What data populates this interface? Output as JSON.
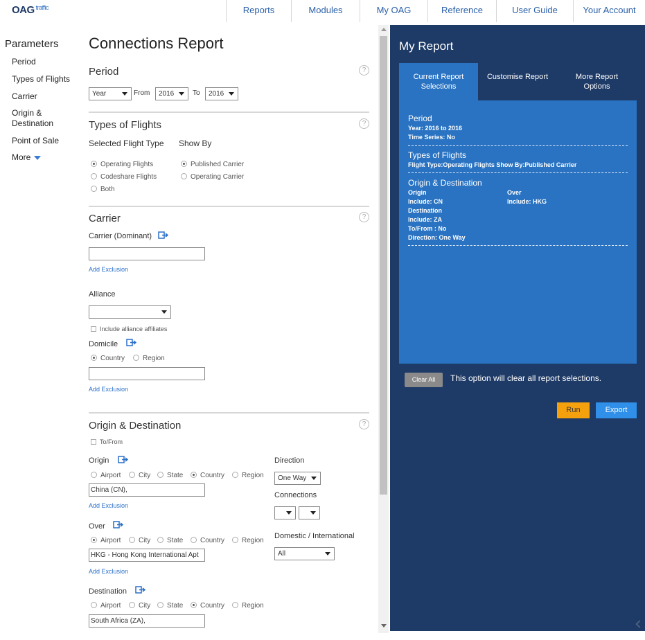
{
  "logo": {
    "main": "OAG",
    "sub": "traffic"
  },
  "nav": [
    {
      "label": "Reports",
      "name": "nav-reports"
    },
    {
      "label": "Modules",
      "name": "nav-modules"
    },
    {
      "label": "My OAG",
      "name": "nav-my-oag"
    },
    {
      "label": "Reference",
      "name": "nav-reference"
    },
    {
      "label": "User Guide",
      "name": "nav-user-guide"
    },
    {
      "label": "Your Account",
      "name": "nav-your-account"
    }
  ],
  "params": {
    "title": "Parameters",
    "items": [
      "Period",
      "Types of Flights",
      "Carrier",
      "Origin &",
      "Destination",
      "Point of Sale"
    ],
    "more": "More"
  },
  "form": {
    "page_title": "Connections Report",
    "help": "?",
    "period": {
      "title": "Period",
      "period_type": "Year",
      "from_label": "From",
      "from_value": "2016",
      "to_label": "To",
      "to_value": "2016"
    },
    "types": {
      "title": "Types of Flights",
      "selected_label": "Selected Flight Type",
      "show_by_label": "Show By",
      "flight_types": [
        "Operating Flights",
        "Codeshare Flights",
        "Both"
      ],
      "show_by": [
        "Published Carrier",
        "Operating Carrier"
      ]
    },
    "carrier": {
      "title": "Carrier",
      "dominant_label": "Carrier (Dominant)",
      "dominant_value": "",
      "add_exclusion": "Add Exclusion",
      "alliance_label": "Alliance",
      "alliance_value": "",
      "include_affiliates": "Include alliance affiliates",
      "domicile_label": "Domicile",
      "domicile_country": "Country",
      "domicile_region": "Region",
      "domicile_value": "",
      "add_exclusion_2": "Add Exclusion"
    },
    "od": {
      "title": "Origin & Destination",
      "to_from": "To/From",
      "origin_label": "Origin",
      "geo": [
        "Airport",
        "City",
        "State",
        "Country",
        "Region"
      ],
      "origin_value": "China (CN),",
      "add_exclusion_origin": "Add Exclusion",
      "over_label": "Over",
      "over_value": "HKG - Hong Kong International Apt",
      "add_exclusion_over": "Add Exclusion",
      "destination_label": "Destination",
      "destination_value": "South Africa (ZA),",
      "direction_label": "Direction",
      "direction_value": "One Way",
      "connections_label": "Connections",
      "conn_min": "",
      "conn_max": "",
      "domestic_label": "Domestic / International",
      "domestic_value": "All"
    }
  },
  "report": {
    "title": "My Report",
    "tabs": [
      {
        "line1": "Current Report",
        "line2": "Selections"
      },
      {
        "line1": "Customise Report",
        "line2": ""
      },
      {
        "line1": "More Report",
        "line2": "Options"
      }
    ],
    "period_h": "Period",
    "period_year": "Year: 2016  to 2016",
    "period_ts": "Time Series: No",
    "types_h": "Types of Flights",
    "types_line": "Flight Type:Operating Flights    Show By:Published Carrier",
    "od_h": "Origin & Destination",
    "origin_h": "Origin",
    "origin_inc": "Include: CN",
    "over_h": "Over",
    "over_inc": "Include: HKG",
    "dest_h": "Destination",
    "dest_inc": "Include: ZA",
    "tofrom": "To/From : No",
    "direction": "Direction: One Way",
    "clear_label": "Clear All",
    "clear_note": "This option will clear all report selections.",
    "run_label": "Run",
    "export_label": "Export"
  }
}
